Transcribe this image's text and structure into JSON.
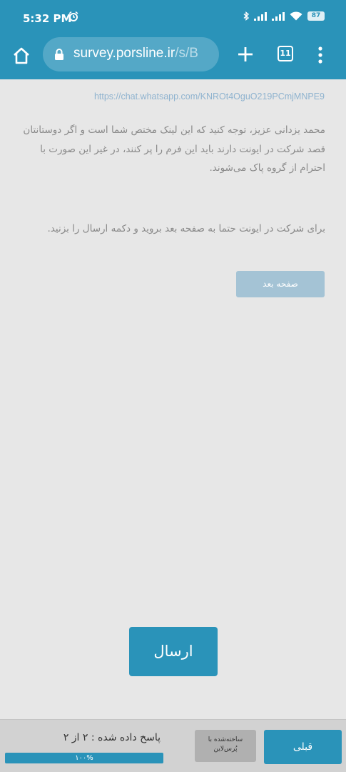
{
  "status_bar": {
    "time": "5:32 PM",
    "battery": "87",
    "icons": [
      "alarm-icon",
      "bluetooth-icon",
      "signal-icon",
      "signal-icon",
      "wifi-icon",
      "battery-icon"
    ]
  },
  "browser": {
    "url_host": "survey.porsline.ir",
    "url_path": "/s/B",
    "tab_count": "11",
    "icons": [
      "home-icon",
      "lock-icon",
      "plus-icon",
      "tabs-icon",
      "menu-icon"
    ]
  },
  "content": {
    "link": "https://chat.whatsapp.com/KNROt4OguO219PCmjMNPE9",
    "paragraph_1": "محمد یزدانی عزیز، توجه کنید که این لینک مختص شما است و اگر دوستانتان قصد شرکت در ایونت دارند باید این فرم را پر کنند، در غیر این صورت با احترام از گروه پاک می‌شوند.",
    "paragraph_2": "برای شرکت در ایونت حتما به صفحه بعد بروید و دکمه ارسال را بزنید.",
    "next_page_button": "صفحه بعد",
    "submit_button": "ارسال"
  },
  "footer": {
    "progress_text": "پاسخ داده شده : ۲ از ۲",
    "progress_value": 1.0,
    "progress_label": "۱۰۰%",
    "brand_line_1": "ساخته‌شده با",
    "brand_line_2": "پُرس‌لاین",
    "prev_button": "قبلی"
  },
  "colors": {
    "primary": "#2a93b9",
    "disabled_button": "#a4c3d5",
    "background": "#e7e7e7",
    "footer": "#d2d2d2"
  }
}
